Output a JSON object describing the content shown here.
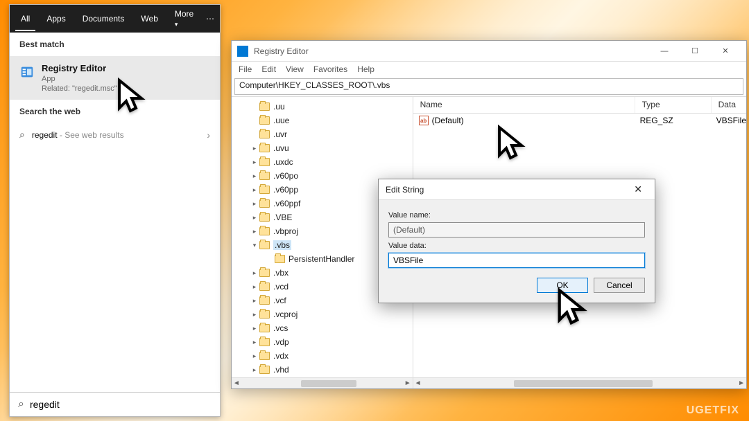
{
  "start": {
    "tabs": {
      "all": "All",
      "apps": "Apps",
      "documents": "Documents",
      "web": "Web",
      "more": "More"
    },
    "best_match_header": "Best match",
    "result": {
      "title": "Registry Editor",
      "subtitle": "App",
      "related": "Related: \"regedit.msc\""
    },
    "search_web_header": "Search the web",
    "web_result": {
      "term": "regedit",
      "suffix": " - See web results"
    },
    "search_icon_glyph": "⌕",
    "search_value": "regedit"
  },
  "regedit": {
    "title": "Registry Editor",
    "menu": {
      "file": "File",
      "edit": "Edit",
      "view": "View",
      "favorites": "Favorites",
      "help": "Help"
    },
    "address": "Computer\\HKEY_CLASSES_ROOT\\.vbs",
    "tree": [
      {
        "name": ".uu",
        "expandable": false
      },
      {
        "name": ".uue",
        "expandable": false
      },
      {
        "name": ".uvr",
        "expandable": false
      },
      {
        "name": ".uvu",
        "expandable": true
      },
      {
        "name": ".uxdc",
        "expandable": true
      },
      {
        "name": ".v60po",
        "expandable": true
      },
      {
        "name": ".v60pp",
        "expandable": true
      },
      {
        "name": ".v60ppf",
        "expandable": true
      },
      {
        "name": ".VBE",
        "expandable": true
      },
      {
        "name": ".vbproj",
        "expandable": true
      },
      {
        "name": ".vbs",
        "expandable": true,
        "expanded": true,
        "selected": true,
        "children": [
          "PersistentHandler"
        ]
      },
      {
        "name": ".vbx",
        "expandable": true
      },
      {
        "name": ".vcd",
        "expandable": true
      },
      {
        "name": ".vcf",
        "expandable": true
      },
      {
        "name": ".vcproj",
        "expandable": true
      },
      {
        "name": ".vcs",
        "expandable": true
      },
      {
        "name": ".vdp",
        "expandable": true
      },
      {
        "name": ".vdx",
        "expandable": true
      },
      {
        "name": ".vhd",
        "expandable": true
      }
    ],
    "list": {
      "columns": {
        "name": "Name",
        "type": "Type",
        "data": "Data"
      },
      "row": {
        "name": "(Default)",
        "type": "REG_SZ",
        "data": "VBSFile",
        "icon_text": "ab"
      }
    }
  },
  "dialog": {
    "title": "Edit String",
    "value_name_label": "Value name:",
    "value_name": "(Default)",
    "value_data_label": "Value data:",
    "value_data": "VBSFile",
    "ok": "OK",
    "cancel": "Cancel"
  },
  "watermark": "UGETFIX"
}
